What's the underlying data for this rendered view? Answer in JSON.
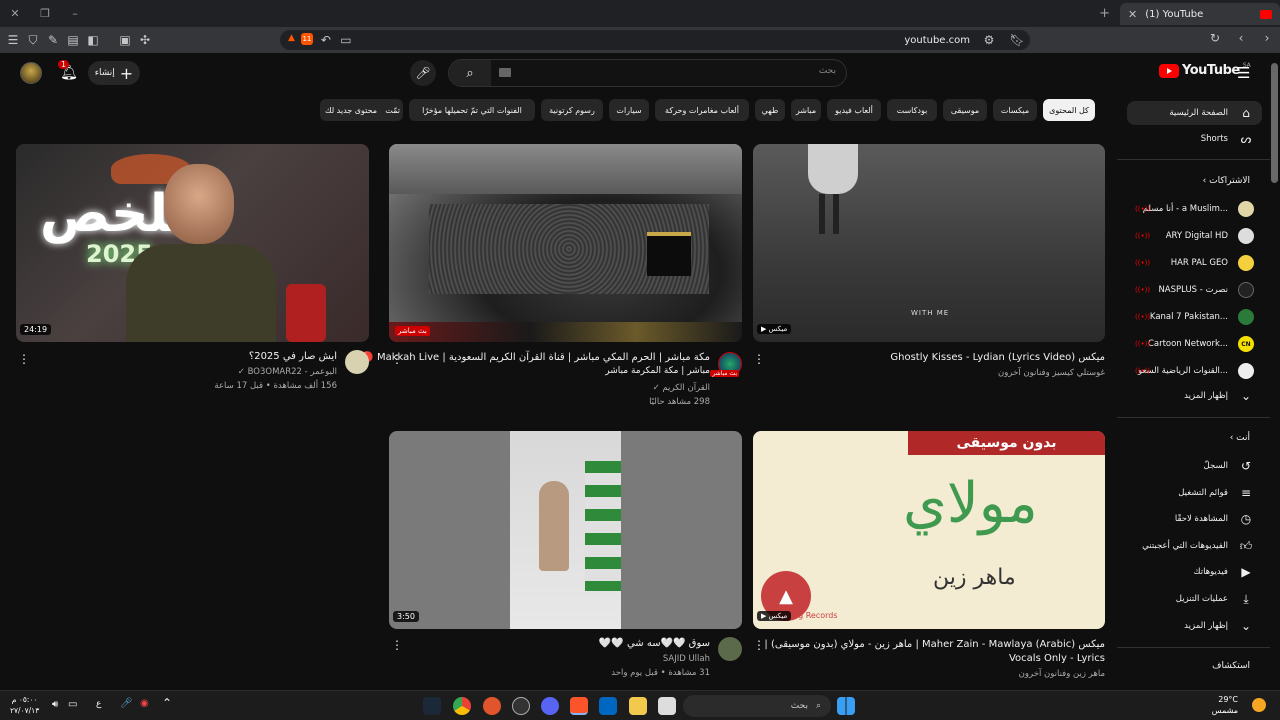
{
  "browser": {
    "tab_title": "(1) YouTube",
    "url": "youtube.com"
  },
  "header": {
    "create_label": "إنشاء",
    "notif_count": "1",
    "search_placeholder": "بحث",
    "logo_text": "YouTube",
    "region": "SA"
  },
  "chips": [
    {
      "label": "كل المحتوى",
      "active": true
    },
    {
      "label": "ميكسات"
    },
    {
      "label": "موسيقى"
    },
    {
      "label": "بودكاست"
    },
    {
      "label": "ألعاب فيديو"
    },
    {
      "label": "مباشر"
    },
    {
      "label": "طهي"
    },
    {
      "label": "ألعاب مغامرات وحركة"
    },
    {
      "label": "سيارات"
    },
    {
      "label": "رسوم كرتونية"
    },
    {
      "label": "الفنوات التي تمّ تحميلها مؤخرًا"
    },
    {
      "label": "تمّت مشاهدتها"
    },
    {
      "label": "محتوى جديد لك"
    }
  ],
  "videos": [
    {
      "title": "ايش صار في 2025؟",
      "channel": "البوعمر - BO3OMAR22",
      "meta": "156 ألف مشاهدة • قبل 17 ساعة",
      "duration": "24:19"
    },
    {
      "title": "مكة مباشر | الحرم المكي مباشر | قناة القرآن الكريم السعودية | Makkah Live 🔴",
      "title2": "مباشر | مكة المكرمة مباشر",
      "channel": "القرآن الكريم",
      "meta": "298 مشاهد حاليًا",
      "badge": "بث مباشر"
    },
    {
      "title": "ميكس Ghostly Kisses - Lydian (Lyrics Video)",
      "channel": "غوستلي كيسيز وفنانون آخرون",
      "mix": "ميكس",
      "overlay": "WITH ME"
    },
    {
      "title": "سوق 🤍🤍سه شي 🤍🤍",
      "channel": "SAJID Ullah",
      "meta": "31 مشاهدة • قبل يوم واحد",
      "duration": "3:50"
    },
    {
      "title": "ميكس Maher Zain - Mawlaya (Arabic) | ماهر زين - مولاي (بدون موسيقى) |",
      "title2": "Vocals Only - Lyrics",
      "channel": "ماهر زين وفنانون آخرون",
      "mix": "ميكس",
      "banner": "بدون موسيقى",
      "art1": "مولاي",
      "art2": "ماهر زين",
      "label": "ming Records"
    }
  ],
  "sidebar": {
    "home": "الصفحة الرئيسية",
    "shorts": "Shorts",
    "subs_head": "الاشتراكات",
    "subs": [
      {
        "name": "أنا مسلم - a Muslim..."
      },
      {
        "name": "ARY Digital HD"
      },
      {
        "name": "HAR PAL GEO"
      },
      {
        "name": "NASPLUS - نصرت"
      },
      {
        "name": "Kanal 7 Pakistan..."
      },
      {
        "name": "Cartoon Network..."
      },
      {
        "name": "القنوات الرياضية السعو..."
      }
    ],
    "show_more": "إظهار المزيد",
    "you_head": "أنت",
    "you": [
      {
        "name": "السجلّ"
      },
      {
        "name": "قوائم التشغيل"
      },
      {
        "name": "المشاهدة لاحقًا"
      },
      {
        "name": "الفيديوهات التي أعجبتني"
      },
      {
        "name": "فيديوهاتك"
      },
      {
        "name": "عمليات التنزيل"
      }
    ],
    "show_more2": "إظهار المزيد",
    "explore_head": "استكشاف"
  },
  "taskbar": {
    "time": "٠٥:٠٠ م",
    "date": "٢٧/٠٧/١٣",
    "lang": "ع",
    "search_label": "بحث",
    "temp": "29°C",
    "weather": "مشمس"
  }
}
